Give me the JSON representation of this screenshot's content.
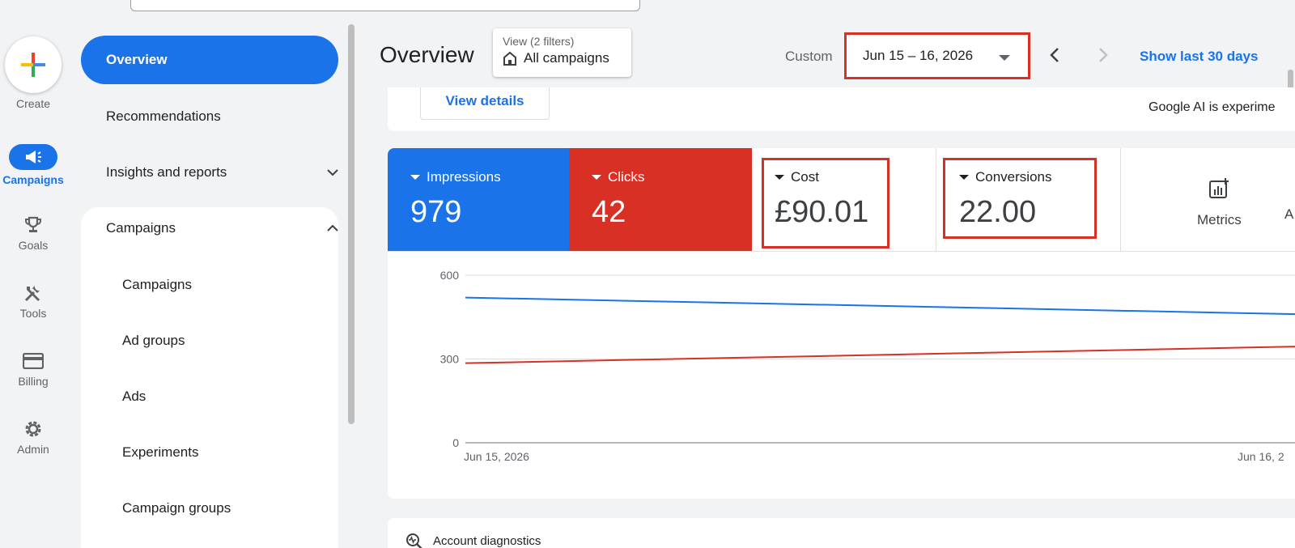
{
  "rail": {
    "create_label": "Create",
    "items": [
      {
        "label": "Campaigns",
        "icon": "megaphone-icon",
        "active": true
      },
      {
        "label": "Goals",
        "icon": "trophy-icon"
      },
      {
        "label": "Tools",
        "icon": "tools-icon"
      },
      {
        "label": "Billing",
        "icon": "credit-card-icon"
      },
      {
        "label": "Admin",
        "icon": "gear-icon"
      }
    ]
  },
  "nav": {
    "active": "Overview",
    "items": [
      "Recommendations",
      "Insights and reports"
    ],
    "section": "Campaigns",
    "sub_items": [
      "Campaigns",
      "Ad groups",
      "Ads",
      "Experiments",
      "Campaign groups"
    ]
  },
  "header": {
    "title": "Overview",
    "view_filters": "View (2 filters)",
    "view_value": "All campaigns",
    "date_mode": "Custom",
    "date_range": "Jun 15 – 16, 2026",
    "show_last": "Show last 30 days"
  },
  "top_card": {
    "view_details": "View details",
    "ai_note": "Google AI is experime"
  },
  "metrics": {
    "tiles": [
      {
        "label": "Impressions",
        "value": "979",
        "color": "#1a73e8"
      },
      {
        "label": "Clicks",
        "value": "42",
        "color": "#d93025"
      },
      {
        "label": "Cost",
        "value": "£90.01"
      },
      {
        "label": "Conversions",
        "value": "22.00"
      }
    ],
    "metrics_button": "Metrics",
    "cutoff_text": "A"
  },
  "chart_data": {
    "type": "line",
    "x": [
      "Jun 15, 2026",
      "Jun 16, 2"
    ],
    "ylim": [
      0,
      600
    ],
    "y_ticks": [
      "600",
      "300",
      "0"
    ],
    "series": [
      {
        "color": "#1a73e8",
        "values": [
          520,
          460
        ]
      },
      {
        "color": "#d93025",
        "values": [
          285,
          345
        ]
      }
    ]
  },
  "diagnostics": {
    "label": "Account diagnostics"
  }
}
